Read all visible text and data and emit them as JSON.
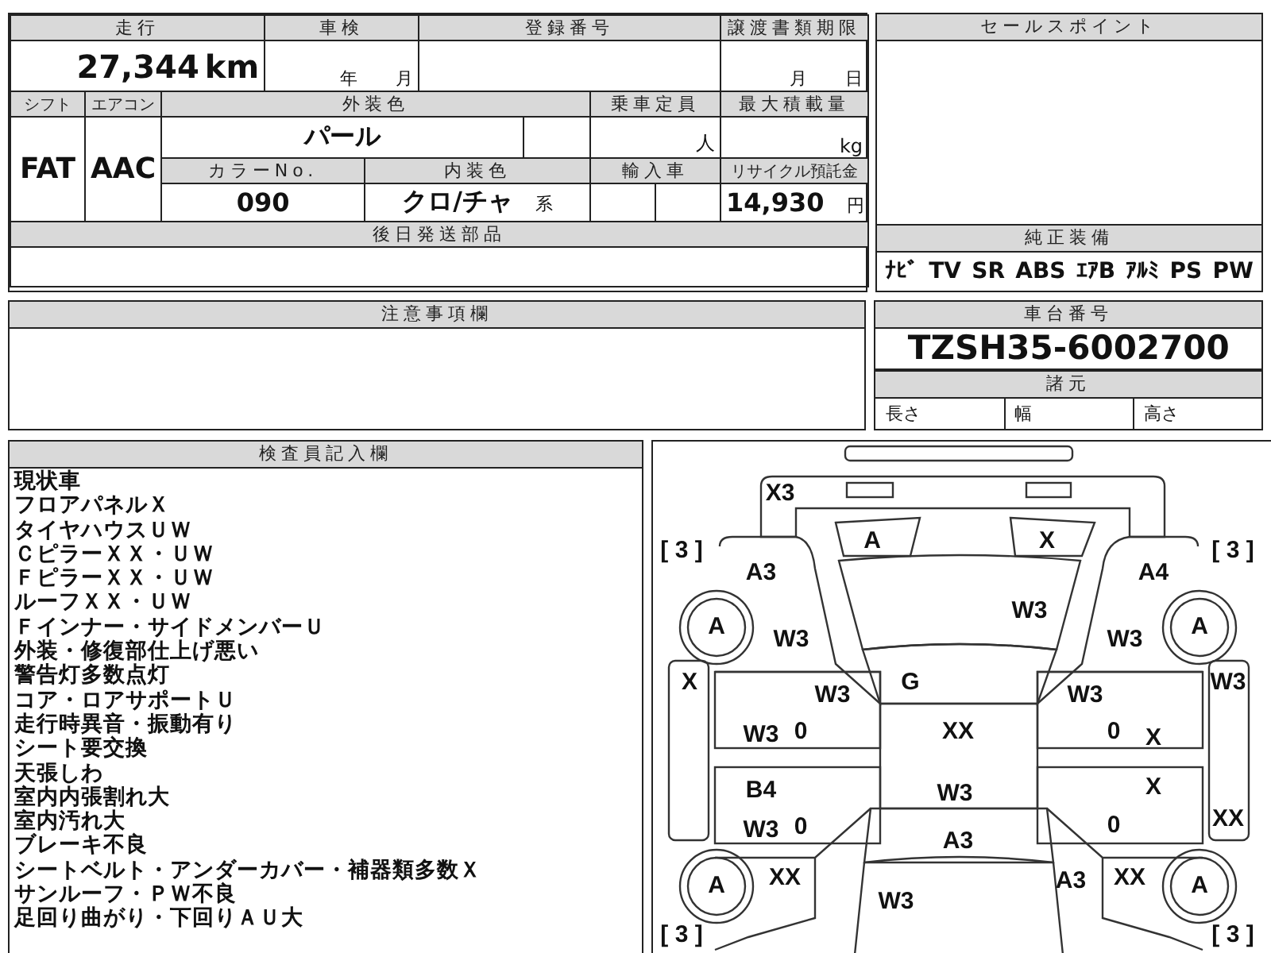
{
  "vehicle_form": {
    "mileage": {
      "label": "走行",
      "value": "27,344",
      "unit": "km"
    },
    "inspection": {
      "label": "車検",
      "year_unit": "年",
      "month_unit": "月"
    },
    "registration_number": {
      "label": "登録番号"
    },
    "transfer_deadline": {
      "label": "譲渡書類期限",
      "month_unit": "月",
      "day_unit": "日"
    },
    "shift": {
      "label": "シフト",
      "value": "FAT"
    },
    "air_conditioner": {
      "label": "エアコン",
      "value": "AAC"
    },
    "exterior_color": {
      "label": "外装色",
      "value": "パール"
    },
    "capacity": {
      "label": "乗車定員",
      "unit": "人"
    },
    "max_load": {
      "label": "最大積載量",
      "unit": "kg"
    },
    "color_number": {
      "label": "カラーNo.",
      "value": "090"
    },
    "interior_color": {
      "label": "内装色",
      "value": "クロ/チャ",
      "suffix": "系"
    },
    "imported": {
      "label": "輸入車"
    },
    "recycle_deposit": {
      "label": "リサイクル預託金",
      "value": "14,930",
      "unit": "円"
    },
    "later_parts": {
      "label": "後日発送部品"
    }
  },
  "sales_point": {
    "label": "セールスポイント"
  },
  "equipment": {
    "label": "純正装備",
    "items": [
      "ﾅﾋﾞ",
      "TV",
      "SR",
      "ABS",
      "ｴｱB",
      "ｱﾙﾐ",
      "PS",
      "PW"
    ]
  },
  "notes": {
    "label": "注意事項欄"
  },
  "chassis": {
    "label": "車台番号",
    "value": "TZSH35-6002700"
  },
  "specs": {
    "label": "諸元",
    "items": [
      "長さ",
      "幅",
      "高さ"
    ]
  },
  "inspector_notes": {
    "label": "検査員記入欄",
    "lines": [
      "現状車",
      "フロアパネルＸ",
      "タイヤハウスＵＷ",
      "ＣピラーＸＸ・ＵＷ",
      "ＦピラーＸＸ・ＵＷ",
      "ルーフＸＸ・ＵＷ",
      "Ｆインナー・サイドメンバーＵ",
      "外装・修復部仕上げ悪い",
      "警告灯多数点灯",
      "コア・ロアサポートＵ",
      "走行時異音・振動有り",
      "シート要交換",
      "天張しわ",
      "室内内張割れ大",
      "室内汚れ大",
      "ブレーキ不良",
      "シートベルト・アンダーカバー・補器類多数Ｘ",
      "サンルーフ・ＰＷ不良",
      "足回り曲がり・下回りＡＵ大"
    ]
  },
  "damage_diagram": {
    "tread_depths": [
      "[ 3 ]",
      "[ 3 ]",
      "[ 3 ]",
      "[ 3 ]"
    ],
    "marks": [
      "X3",
      "A",
      "X",
      "A3",
      "A4",
      "A",
      "A",
      "A",
      "A",
      "W3",
      "W3",
      "W3",
      "X",
      "W3",
      "G",
      "W3",
      "W3",
      "W3",
      "0",
      "XX",
      "0",
      "X",
      "B4",
      "W3",
      "X",
      "W3",
      "0",
      "0",
      "XX",
      "A3",
      "XX",
      "A3",
      "XX",
      "W3"
    ]
  }
}
